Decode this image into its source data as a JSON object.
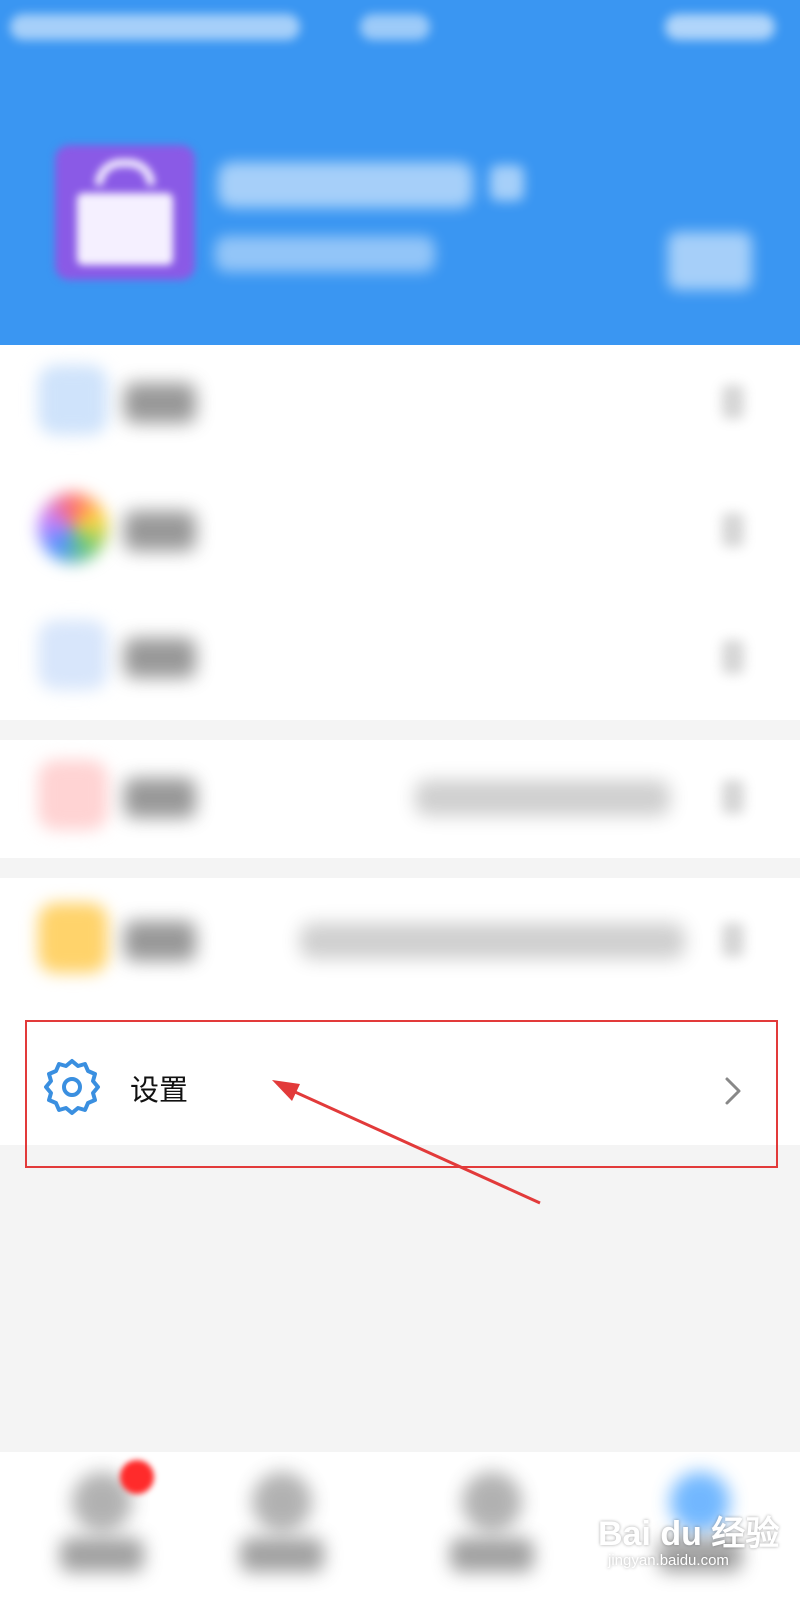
{
  "colors": {
    "header_blue": "#3a96f2",
    "highlight_red": "#e23a3a",
    "gear_blue": "#3a8fe0",
    "page_gray": "#f4f4f4"
  },
  "header": {
    "status_bar": "blurred",
    "profile": {
      "avatar_icon": "gift-box-icon",
      "username": "blurred",
      "subtitle": "blurred",
      "qr_icon": "qr-code-icon"
    }
  },
  "menu_items": [
    {
      "id": "item-1",
      "label": "blurred",
      "icon": "calendar-icon"
    },
    {
      "id": "item-2",
      "label": "blurred",
      "icon": "colorful-wheel-icon"
    },
    {
      "id": "item-3",
      "label": "blurred",
      "icon": "clock-icon"
    },
    {
      "id": "item-4",
      "label": "blurred",
      "value": "blurred",
      "icon": "red-badge-icon"
    },
    {
      "id": "item-5",
      "label": "blurred",
      "value": "blurred",
      "icon": "flame-icon"
    }
  ],
  "settings": {
    "label": "设置",
    "icon": "gear-icon",
    "chevron": "chevron-right-icon",
    "highlighted": true
  },
  "annotation": {
    "arrow": "red arrow pointing to settings"
  },
  "tabbar": {
    "tabs": [
      {
        "label": "blurred",
        "has_badge": true
      },
      {
        "label": "blurred",
        "has_badge": false
      },
      {
        "label": "blurred",
        "has_badge": false
      },
      {
        "label": "blurred",
        "has_badge": false,
        "active": true
      }
    ]
  },
  "watermark": {
    "main": "Bai du 经验",
    "sub": "jingyan.baidu.com"
  }
}
